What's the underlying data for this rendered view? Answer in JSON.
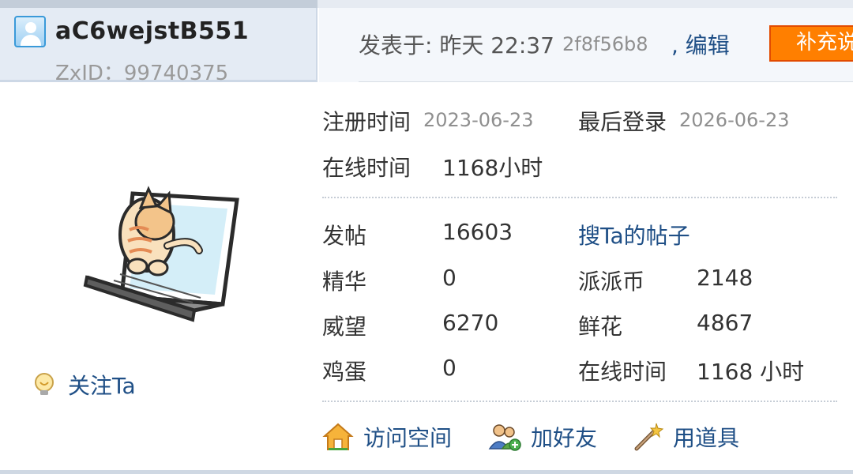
{
  "user": {
    "name": "aC6wejstB551",
    "zxid_label": "ZxID：",
    "zxid_value": "99740375",
    "avatar_icon": "user-avatar-icon"
  },
  "post": {
    "time": "发表于: 昨天 22:37",
    "hash": "2f8f56b8",
    "edit": ", 编辑",
    "supplement": "补充说明"
  },
  "profile": {
    "reg_label": "注册时间",
    "reg_value": "2023-06-23",
    "last_login_label": "最后登录",
    "last_login_value": "2026-06-23",
    "online_label": "在线时间",
    "online_value": "1168小时"
  },
  "stats": {
    "posts_label": "发帖",
    "posts_value": "16603",
    "search_link": "搜Ta的帖子",
    "digest_label": "精华",
    "digest_value": "0",
    "coins_label": "派派币",
    "coins_value": "2148",
    "prestige_label": "威望",
    "prestige_value": "6270",
    "flowers_label": "鲜花",
    "flowers_value": "4867",
    "eggs_label": "鸡蛋",
    "eggs_value": "0",
    "online2_label": "在线时间",
    "online2_value": "1168 小时"
  },
  "actions": {
    "follow": "关注Ta",
    "visit_space": "访问空间",
    "add_friend": "加好友",
    "use_item": "用道具"
  },
  "colors": {
    "link": "#1f4f86",
    "header_bg": "#e4ebf4",
    "button_orange": "#ff7f00"
  }
}
